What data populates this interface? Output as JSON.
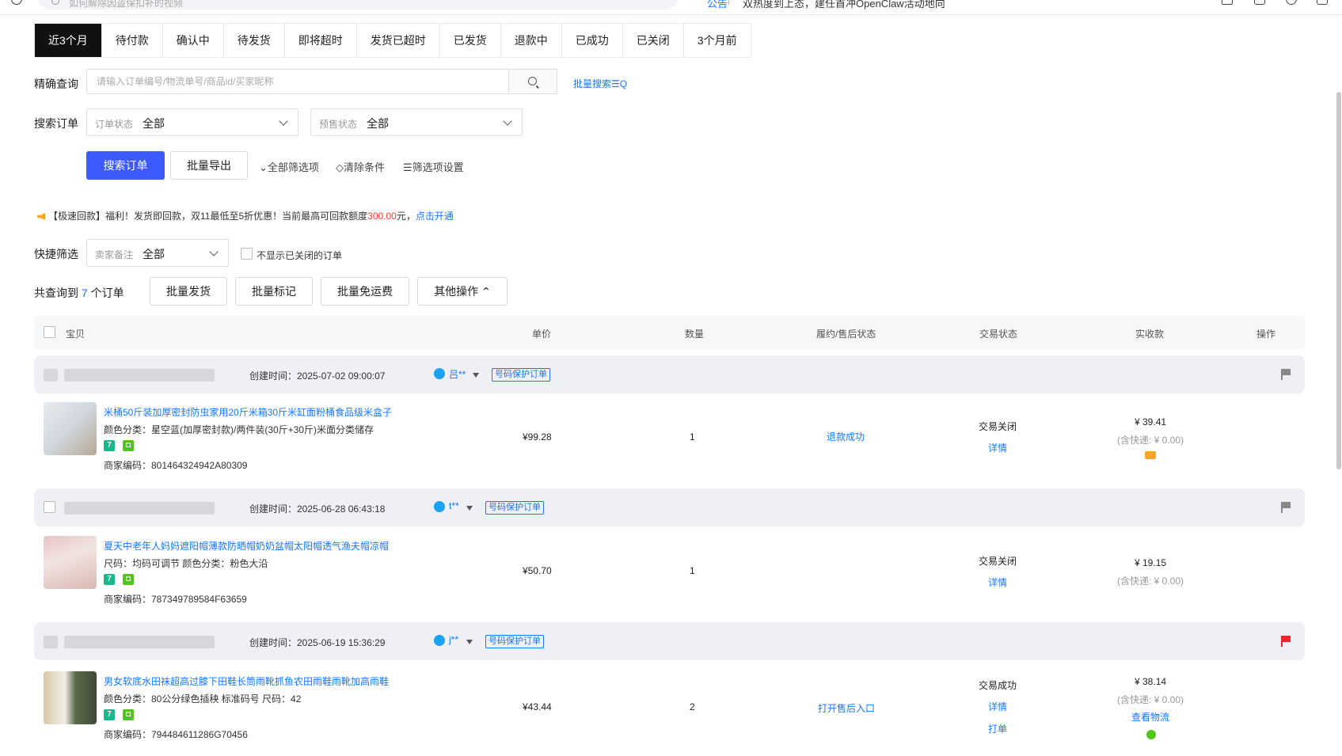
{
  "topbar": {
    "search_placeholder": "如何解除因盗保扣补的视频",
    "notice_tag": "公告",
    "notice_text": "双热度到上态，建任首冲OpenClaw活动地向"
  },
  "tabs": [
    "近3个月",
    "待付款",
    "确认中",
    "待发货",
    "即将超时",
    "发货已超时",
    "已发货",
    "退款中",
    "已成功",
    "已关闭",
    "3个月前"
  ],
  "tabs_active": 0,
  "exact_query": {
    "label": "精确查询",
    "placeholder": "请输入订单编号/物流单号/商品id/买家昵称",
    "bulk_search": "批量搜索☰Q"
  },
  "search_orders": {
    "label": "搜索订单",
    "order_status_caption": "订单状态",
    "order_status_value": "全部",
    "presale_caption": "预售状态",
    "presale_value": "全部"
  },
  "actions": {
    "search_button": "搜索订单",
    "export_button": "批量导出",
    "all_filters": "⌄全部筛选项",
    "clear_filters": "◇清除条件",
    "filter_settings": "☰筛选项设置"
  },
  "promo": {
    "prefix": "【极速回款】福利！发货即回款，双11最低至5折优惠！当前最高可回款额度",
    "amount": "300.00",
    "suffix": "元，",
    "link": "点击开通"
  },
  "quick_filter": {
    "label": "快捷筛选",
    "remark_caption": "卖家备注",
    "remark_value": "全部",
    "hide_closed_label": "不显示已关闭的订单"
  },
  "results": {
    "prefix": "共查询到",
    "count": "7",
    "suffix": "个订单",
    "bulk_ship": "批量发货",
    "bulk_mark": "批量标记",
    "bulk_free_shipping": "批量免运费",
    "other_ops": "其他操作 ⌃"
  },
  "table_header": {
    "item": "宝贝",
    "unit_price": "单价",
    "quantity": "数量",
    "fulfillment": "履约/售后状态",
    "trade_status": "交易状态",
    "received": "实收款",
    "operation": "操作"
  },
  "orders": [
    {
      "created": "创建时间：2025-07-02 09:00:07",
      "buyer": "吕**",
      "tag": "号码保护订单",
      "flag_color": "#888888",
      "title": "米桶50斤装加厚密封防虫家用20斤米箱30斤米缸面粉桶食品级米盒子",
      "spec": "颜色分类：星空蓝(加厚密封款)/两件装(30斤+30斤)米面分类储存",
      "code": "商家编码：801464324942A80309",
      "price": "¥99.28",
      "qty": "1",
      "fulfillment": "退款成功",
      "trade_status": "交易关闭",
      "detail": "详情",
      "received": "¥ 39.41",
      "shipping": "(含快递: ¥ 0.00)"
    },
    {
      "created": "创建时间：2025-06-28 06:43:18",
      "buyer": "t**",
      "tag": "号码保护订单",
      "flag_color": "#888888",
      "title": "夏天中老年人妈妈遮阳帽薄款防晒帽奶奶盆帽太阳帽透气渔夫帽凉帽",
      "spec": "尺码：均码可调节   颜色分类：粉色大沿",
      "code": "商家编码：787349789584F63659",
      "price": "¥50.70",
      "qty": "1",
      "fulfillment": "",
      "trade_status": "交易关闭",
      "detail": "详情",
      "received": "¥ 19.15",
      "shipping": "(含快递: ¥ 0.00)"
    },
    {
      "created": "创建时间：2025-06-19 15:36:29",
      "buyer": "j**",
      "tag": "号码保护订单",
      "flag_color": "#f5222d",
      "title": "男女软底水田袜超高过膝下田鞋长筒雨靴抓鱼农田雨鞋雨靴加高雨鞋",
      "spec": "颜色分类：80公分绿色插秧 标准码号   尺码：42",
      "code": "商家编码：794484611286G70456",
      "price": "¥43.44",
      "qty": "2",
      "fulfillment": "打开售后入口",
      "trade_status": "交易成功",
      "detail": "详情",
      "print": "打单",
      "received": "¥ 38.14",
      "shipping": "(含快递: ¥ 0.00)",
      "logistics": "查看物流"
    }
  ]
}
